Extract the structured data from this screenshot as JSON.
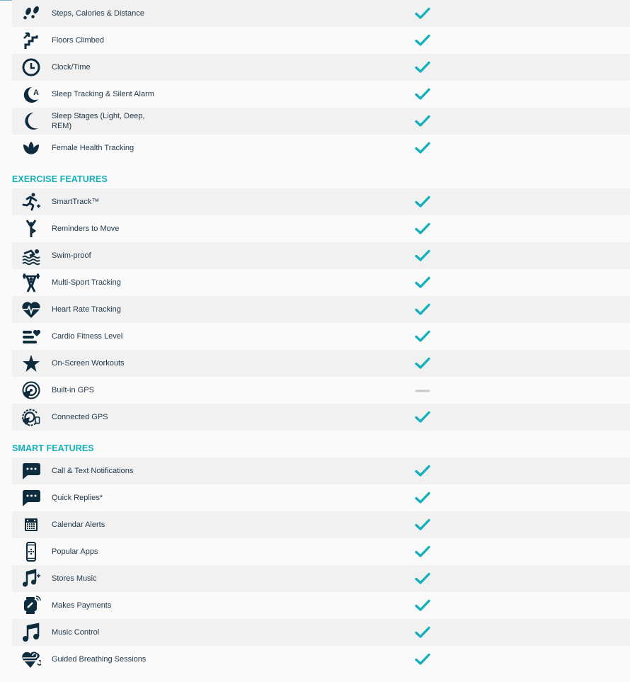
{
  "colors": {
    "accent": "#14b1bb",
    "text": "#23394a",
    "icon": "#0e2c3e",
    "row_alt": "#f1f1f1",
    "row": "#fafafa",
    "dash": "#c6cacb"
  },
  "groups": [
    {
      "title": "",
      "rows": [
        {
          "label": "Steps, Calories & Distance",
          "icon": "footsteps-icon",
          "supported": true
        },
        {
          "label": "Floors Climbed",
          "icon": "stairs-icon",
          "supported": true
        },
        {
          "label": "Clock/Time",
          "icon": "clock-icon",
          "supported": true
        },
        {
          "label": "Sleep Tracking & Silent Alarm",
          "icon": "sleep-alarm-icon",
          "supported": true
        },
        {
          "label": "Sleep Stages (Light, Deep, REM)",
          "icon": "moon-icon",
          "supported": true
        },
        {
          "label": "Female Health Tracking",
          "icon": "lotus-icon",
          "supported": true
        }
      ]
    },
    {
      "title": "EXERCISE FEATURES",
      "rows": [
        {
          "label": "SmartTrack™",
          "icon": "runner-icon",
          "supported": true
        },
        {
          "label": "Reminders to Move",
          "icon": "stretch-figure-icon",
          "supported": true
        },
        {
          "label": "Swim-proof",
          "icon": "swimmer-icon",
          "supported": true
        },
        {
          "label": "Multi-Sport Tracking",
          "icon": "weightlifter-icon",
          "supported": true
        },
        {
          "label": "Heart Rate Tracking",
          "icon": "heart-rate-icon",
          "supported": true
        },
        {
          "label": "Cardio Fitness Level",
          "icon": "cardio-level-icon",
          "supported": true
        },
        {
          "label": "On-Screen Workouts",
          "icon": "star-icon",
          "supported": true
        },
        {
          "label": "Built-in GPS",
          "icon": "gps-icon",
          "supported": false
        },
        {
          "label": "Connected GPS",
          "icon": "connected-gps-icon",
          "supported": true
        }
      ]
    },
    {
      "title": "SMART FEATURES",
      "rows": [
        {
          "label": "Call & Text Notifications",
          "icon": "chat-bubble-icon",
          "supported": true
        },
        {
          "label": "Quick Replies*",
          "icon": "chat-bubble-icon",
          "supported": true
        },
        {
          "label": "Calendar Alerts",
          "icon": "calendar-icon",
          "supported": true
        },
        {
          "label": "Popular Apps",
          "icon": "phone-apps-icon",
          "supported": true
        },
        {
          "label": "Stores Music",
          "icon": "music-plus-icon",
          "supported": true
        },
        {
          "label": "Makes Payments",
          "icon": "payment-watch-icon",
          "supported": true
        },
        {
          "label": "Music Control",
          "icon": "music-note-icon",
          "supported": true
        },
        {
          "label": "Guided Breathing Sessions",
          "icon": "breathing-heart-icon",
          "supported": true
        }
      ]
    }
  ]
}
